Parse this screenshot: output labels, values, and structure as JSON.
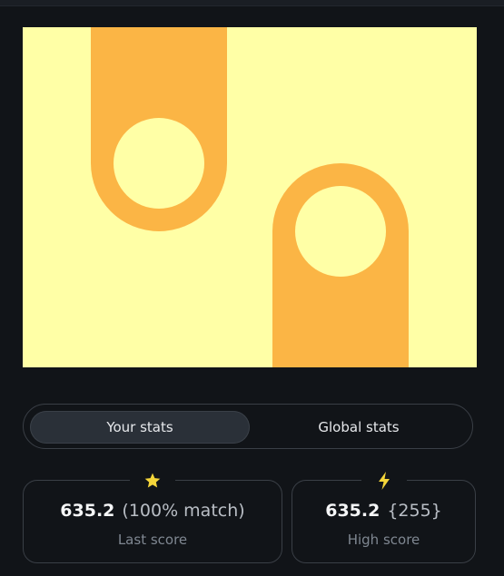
{
  "tabs": {
    "your_stats": "Your stats",
    "global_stats": "Global stats",
    "active": "your_stats"
  },
  "last_score": {
    "icon": "star-icon",
    "value": "635.2",
    "extra": "(100% match)",
    "label": "Last score"
  },
  "high_score": {
    "icon": "lightning-icon",
    "value": "635.2",
    "extra": "{255}",
    "label": "High score"
  },
  "colors": {
    "background": "#111418",
    "preview_bg": "#ffffa6",
    "preview_shape": "#fbb545",
    "icon_yellow": "#f5d63a"
  }
}
